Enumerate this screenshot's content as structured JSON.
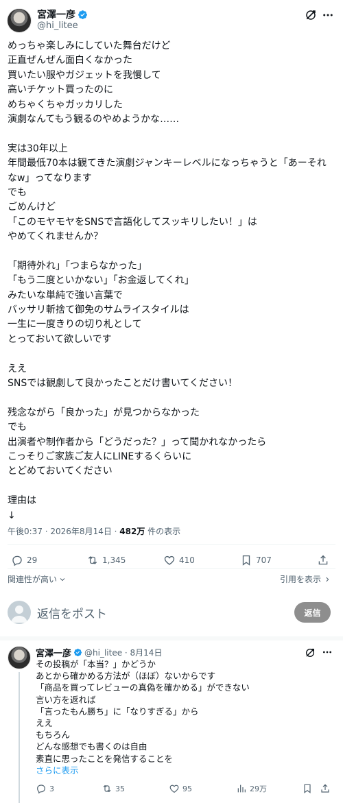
{
  "tweet": {
    "author_name": "宮澤一彦",
    "author_handle": "@hi_litee",
    "lines": [
      "めっちゃ楽しみにしていた舞台だけど",
      "正直ぜんぜん面白くなかった",
      "買いたい服やガジェットを我慢して",
      "高いチケット買ったのに",
      "めちゃくちゃガッカリした",
      "演劇なんてもう観るのやめようかな……",
      "",
      "実は30年以上",
      "年間最低70本は観てきた演劇ジャンキーレベルになっちゃうと「あーそれ",
      "なw」ってなります",
      "でも",
      "ごめんけど",
      "「このモヤモヤをSNSで言語化してスッキリしたい！」は",
      "やめてくれませんか？",
      "",
      "「期待外れ」「つまらなかった」",
      "「もう二度といかない」「お金返してくれ」",
      "みたいな単純で強い言葉で",
      "バッサリ斬捨て御免のサムライスタイルは",
      "一生に一度きりの切り札として",
      "とっておいて欲しいです",
      "",
      "ええ",
      "SNSでは観劇して良かったことだけ書いてください！",
      "",
      "残念ながら「良かった」が見つからなかった",
      "でも",
      "出演者や制作者から「どうだった？」って聞かれなかったら",
      "こっそりご家族ご友人にLINEするくらいに",
      "とどめておいてください",
      "",
      "理由は",
      "↓"
    ],
    "time": "午後0:37 · 2026年8月14日 · ",
    "views_count": "482万",
    "views_label": " 件の表示",
    "replies": "29",
    "reposts": "1,345",
    "likes": "410",
    "bookmarks": "707"
  },
  "sort_label": "関連性が高い",
  "quotes_label": "引用を表示",
  "composer": {
    "placeholder": "返信をポスト",
    "button": "返信"
  },
  "reply": {
    "author_name": "宮澤一彦",
    "handle_date": "@hi_litee · 8月14日",
    "lines": [
      "その投稿が「本当？」かどうか",
      "あとから確かめる方法が（ほぼ）ないからです",
      "「商品を買ってレビューの真偽を確かめる」ができない",
      "言い方を返れば",
      "「言ったもん勝ち」に「なりすぎる」から",
      "ええ",
      "もちろん",
      "どんな感想でも書くのは自由",
      "素直に思ったことを発信することを"
    ],
    "show_more": "さらに表示",
    "replies": "3",
    "reposts": "35",
    "likes": "95",
    "views": "29万"
  }
}
